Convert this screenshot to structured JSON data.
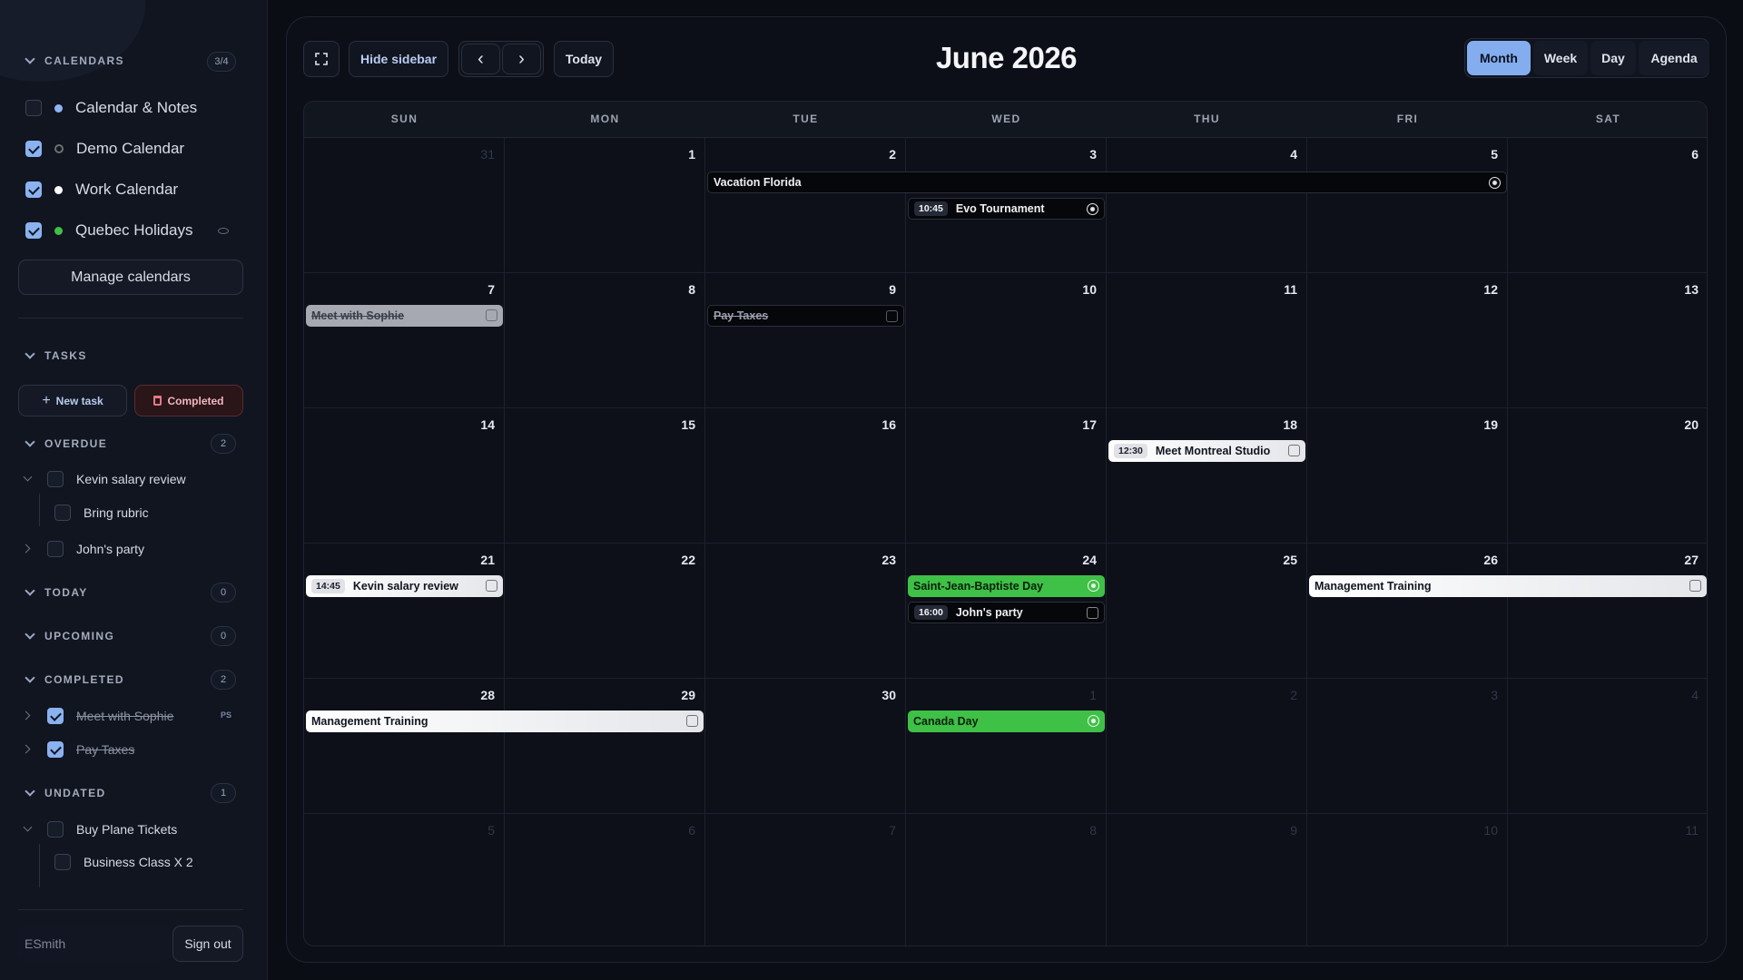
{
  "sidebar": {
    "calendars": {
      "title": "CALENDARS",
      "count": "3/4",
      "items": [
        {
          "label": "Calendar & Notes",
          "color": "#8fb4f5",
          "checked": false
        },
        {
          "label": "Demo Calendar",
          "color": "#7a7a7a",
          "checked": true
        },
        {
          "label": "Work Calendar",
          "color": "#ffffff",
          "checked": true
        },
        {
          "label": "Quebec Holidays",
          "color": "#3fc046",
          "checked": true
        }
      ],
      "manage_label": "Manage calendars"
    },
    "tasks": {
      "title": "TASKS",
      "new_task_label": "New task",
      "completed_label": "Completed",
      "groups": [
        {
          "title": "OVERDUE",
          "count": "2"
        },
        {
          "title": "TODAY",
          "count": "0"
        },
        {
          "title": "UPCOMING",
          "count": "0"
        },
        {
          "title": "COMPLETED",
          "count": "2"
        },
        {
          "title": "UNDATED",
          "count": "1"
        }
      ],
      "overdue_items": [
        {
          "label": "Kevin salary review"
        },
        {
          "label": "Bring rubric"
        },
        {
          "label": "John's party"
        }
      ],
      "completed_items": [
        {
          "label": "Meet with Sophie",
          "tag": "PS"
        },
        {
          "label": "Pay Taxes"
        }
      ],
      "undated_items": [
        {
          "label": "Buy Plane Tickets"
        },
        {
          "label": "Business Class X 2"
        }
      ]
    },
    "user": {
      "name": "ESmith",
      "sign_out_label": "Sign out"
    }
  },
  "toolbar": {
    "hide_sidebar_label": "Hide sidebar",
    "prev_icon": "‹",
    "next_icon": "›",
    "today_label": "Today",
    "title": "June 2026",
    "views": [
      "Month",
      "Week",
      "Day",
      "Agenda"
    ],
    "active_view": "Month"
  },
  "calendar": {
    "day_names": [
      "SUN",
      "MON",
      "TUE",
      "WED",
      "THU",
      "FRI",
      "SAT"
    ],
    "weeks": [
      [
        "31",
        "1",
        "2",
        "3",
        "4",
        "5",
        "6"
      ],
      [
        "7",
        "8",
        "9",
        "10",
        "11",
        "12",
        "13"
      ],
      [
        "14",
        "15",
        "16",
        "17",
        "18",
        "19",
        "20"
      ],
      [
        "21",
        "22",
        "23",
        "24",
        "25",
        "26",
        "27"
      ],
      [
        "28",
        "29",
        "30",
        "1",
        "2",
        "3",
        "4"
      ],
      [
        "5",
        "6",
        "7",
        "8",
        "9",
        "10",
        "11"
      ]
    ],
    "events": [
      {
        "title": "Vacation Florida",
        "time": "",
        "style": "dark"
      },
      {
        "title": "Evo Tournament",
        "time": "10:45",
        "style": "dark"
      },
      {
        "title": "Meet with Sophie",
        "time": "",
        "style": "gray"
      },
      {
        "title": "Pay Taxes",
        "time": "",
        "style": "dark-done"
      },
      {
        "title": "Meet Montreal Studio",
        "time": "12:30",
        "style": "white"
      },
      {
        "title": "Kevin salary review",
        "time": "14:45",
        "style": "white"
      },
      {
        "title": "Saint-Jean-Baptiste Day",
        "time": "",
        "style": "green"
      },
      {
        "title": "John's party",
        "time": "16:00",
        "style": "dark"
      },
      {
        "title": "Management Training",
        "time": "",
        "style": "white"
      },
      {
        "title": "Management Training",
        "time": "",
        "style": "white"
      },
      {
        "title": "Canada Day",
        "time": "",
        "style": "green"
      }
    ]
  }
}
